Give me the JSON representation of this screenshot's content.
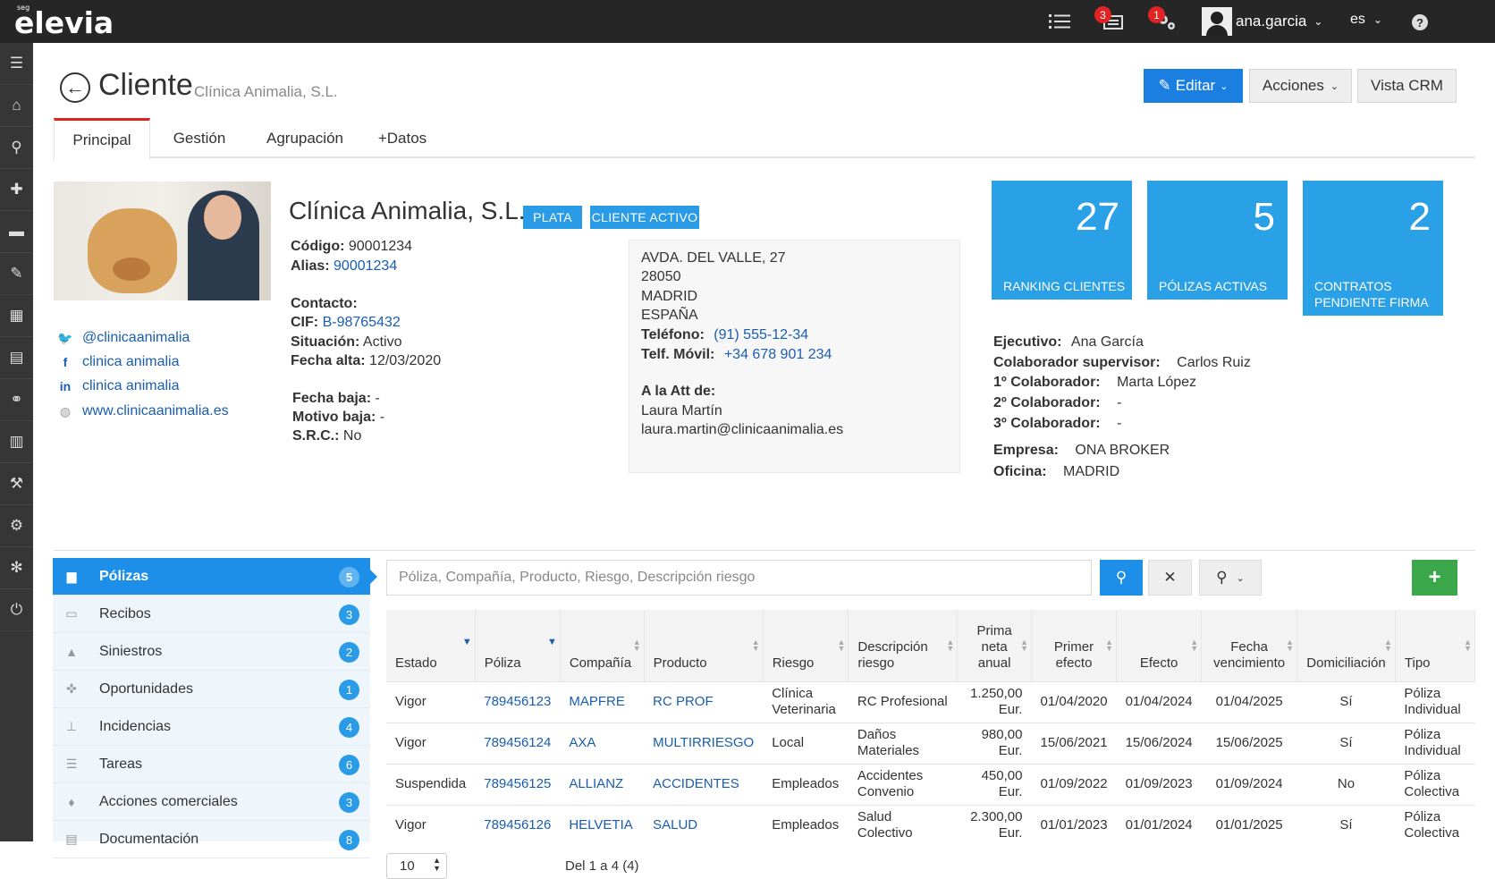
{
  "topbar": {
    "logo": "elevia",
    "logo_small": "seg",
    "badge1": "3",
    "badge2": "1",
    "user": "ana.garcia",
    "lang": "es",
    "help": "?"
  },
  "header": {
    "title": "Cliente",
    "subtitle": "Clínica Animalia, S.L.",
    "edit_label": "Editar",
    "actions_label": "Acciones",
    "crm_label": "Vista CRM"
  },
  "tabs": [
    "Principal",
    "Gestión",
    "Agrupación",
    "+Datos"
  ],
  "client": {
    "name": "Clínica Animalia, S.L.",
    "tag1": "PLATA",
    "tag2": "CLIENTE ACTIVO",
    "codigo_label": "Código:",
    "codigo": "90001234",
    "alias_label": "Alias:",
    "alias": "90001234",
    "contacto_label": "Contacto:",
    "cif_label": "CIF:",
    "cif": "B-98765432",
    "situacion_label": "Situación:",
    "situacion": "Activo",
    "fecha_alta_label": "Fecha alta:",
    "fecha_alta": "12/03/2020",
    "fecha_baja_label": "Fecha baja:",
    "fecha_baja": "-",
    "motivo_baja_label": "Motivo baja:",
    "motivo_baja": "-",
    "src_label": "S.R.C.:",
    "src": "No"
  },
  "social": {
    "twitter": "@clinicaanimalia",
    "facebook": "clinica animalia",
    "linkedin": "clinica animalia",
    "web": "www.clinicaanimalia.es"
  },
  "address": {
    "line1": "AVDA. DEL VALLE, 27",
    "line2": "28050",
    "line3": "MADRID",
    "line4": "ESPAÑA",
    "tel_label": "Teléfono:",
    "tel": "(91) 555-12-34",
    "movil_label": "Telf. Móvil:",
    "movil": "+34 678 901 234",
    "att_label": "A la Att de:",
    "att_name": "Laura Martín",
    "att_email": "laura.martin@clinicaanimalia.es"
  },
  "stats": [
    {
      "num": "27",
      "label": "RANKING CLIENTES"
    },
    {
      "num": "5",
      "label": "PÓLIZAS ACTIVAS"
    },
    {
      "num": "2",
      "label": "CONTRATOS PENDIENTE FIRMA"
    }
  ],
  "people": {
    "ejecutivo_label": "Ejecutivo:",
    "ejecutivo": "Ana García",
    "sup_label": "Colaborador supervisor:",
    "sup": "Carlos Ruiz",
    "c1_label": "1º Colaborador:",
    "c1": "Marta López",
    "c2_label": "2º Colaborador:",
    "c2": "-",
    "c3_label": "3º Colaborador:",
    "c3": "-",
    "empresa_label": "Empresa:",
    "empresa": "ONA BROKER",
    "oficina_label": "Oficina:",
    "oficina": "MADRID"
  },
  "leftnav": [
    {
      "label": "Pólizas",
      "count": "5",
      "icon": "document-icon"
    },
    {
      "label": "Recibos",
      "count": "3",
      "icon": "money-icon"
    },
    {
      "label": "Siniestros",
      "count": "2",
      "icon": "fire-icon"
    },
    {
      "label": "Oportunidades",
      "count": "1",
      "icon": "target-icon"
    },
    {
      "label": "Incidencias",
      "count": "4",
      "icon": "pin-icon"
    },
    {
      "label": "Tareas",
      "count": "6",
      "icon": "tasks-icon"
    },
    {
      "label": "Acciones comerciales",
      "count": "3",
      "icon": "location-icon"
    },
    {
      "label": "Documentación",
      "count": "8",
      "icon": "file-icon"
    }
  ],
  "search": {
    "placeholder": "Póliza, Compañía, Producto, Riesgo, Descripción riesgo"
  },
  "table": {
    "headers": [
      "Estado",
      "Póliza",
      "Compañía",
      "Producto",
      "Riesgo",
      "Descripción riesgo",
      "Prima neta anual",
      "Primer efecto",
      "Efecto",
      "Fecha vencimiento",
      "Domiciliación",
      "Tipo"
    ],
    "rows": [
      [
        "Vigor",
        "789456123",
        "MAPFRE",
        "RC PROF",
        "Clínica Veterinaria",
        "RC Profesional",
        "1.250,00 Eur.",
        "01/04/2020",
        "01/04/2024",
        "01/04/2025",
        "Sí",
        "Póliza Individual"
      ],
      [
        "Vigor",
        "789456124",
        "AXA",
        "MULTIRRIESGO",
        "Local",
        "Daños Materiales",
        "980,00 Eur.",
        "15/06/2021",
        "15/06/2024",
        "15/06/2025",
        "Sí",
        "Póliza Individual"
      ],
      [
        "Suspendida",
        "789456125",
        "ALLIANZ",
        "ACCIDENTES",
        "Empleados",
        "Accidentes Convenio",
        "450,00 Eur.",
        "01/09/2022",
        "01/09/2023",
        "01/09/2024",
        "No",
        "Póliza Colectiva"
      ],
      [
        "Vigor",
        "789456126",
        "HELVETIA",
        "SALUD",
        "Empleados",
        "Salud Colectivo",
        "2.300,00 Eur.",
        "01/01/2023",
        "01/01/2024",
        "01/01/2025",
        "Sí",
        "Póliza Colectiva"
      ]
    ]
  },
  "pager": {
    "size": "10",
    "info": "Del 1 a 4 (4)"
  }
}
